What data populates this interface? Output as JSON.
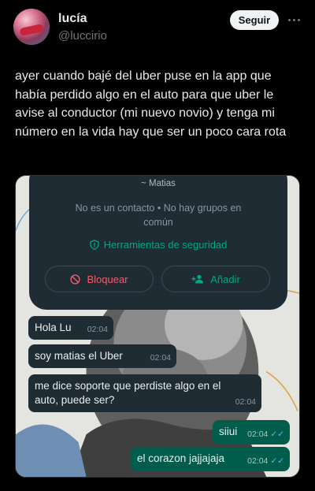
{
  "author": {
    "name": "lucía",
    "handle": "@luccirio"
  },
  "actions": {
    "follow_label": "Seguir",
    "more_icon": "more-icon"
  },
  "tweet": {
    "text": "ayer cuando bajé del uber puse en la app que había perdido algo en el auto para que uber le avise al conductor (mi nuevo novio) y tenga mi número en la vida hay que ser un poco cara rota"
  },
  "screenshot": {
    "contact_card": {
      "name": "~ Matias",
      "subtitle": "No es un contacto • No hay grupos en común",
      "security_label": "Herramientas de seguridad",
      "block_label": "Bloquear",
      "add_label": "Añadir"
    },
    "messages": [
      {
        "text": "Hola Lu",
        "time": "02:04",
        "direction": "in"
      },
      {
        "text": "soy matias el Uber",
        "time": "02:04",
        "direction": "in"
      },
      {
        "text": "me dice soporte que perdiste algo en el auto, puede ser?",
        "time": "02:04",
        "direction": "in"
      },
      {
        "text": "siiui",
        "time": "02:04",
        "direction": "out"
      },
      {
        "text": "el corazon jajjajaja",
        "time": "02:04",
        "direction": "out"
      }
    ]
  },
  "colors": {
    "background": "#000000",
    "accent_green": "#00a884",
    "danger": "#f15c6d",
    "incoming_bubble": "#1f2c34",
    "outgoing_bubble": "#005c4b"
  }
}
